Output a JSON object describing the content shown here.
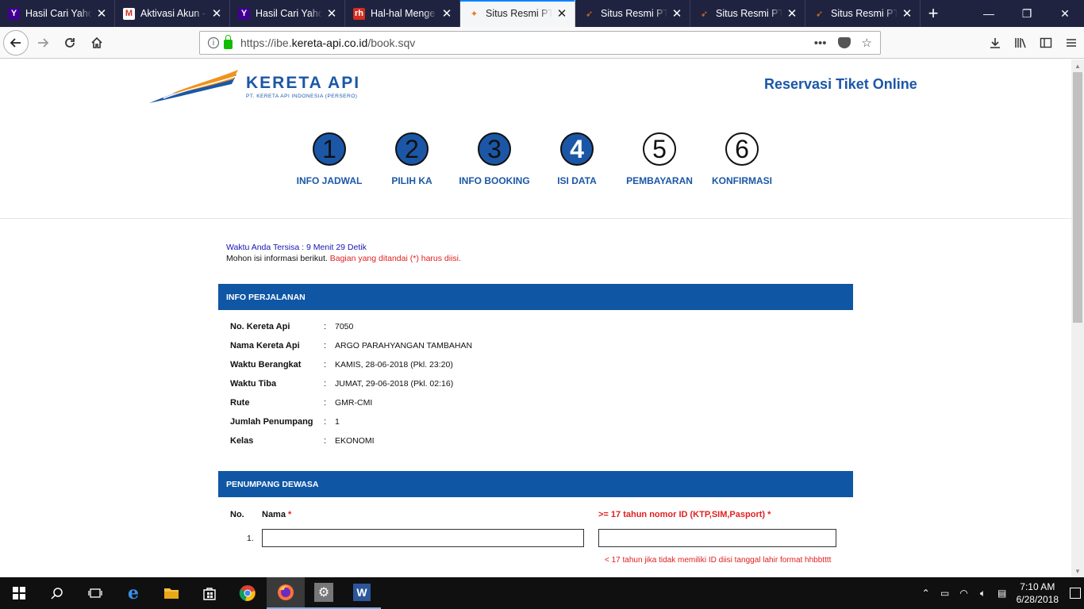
{
  "browser": {
    "tabs": [
      {
        "title": "Hasil Cari Yahoo",
        "favicon": "Y"
      },
      {
        "title": "Aktivasi Akun -",
        "favicon": "M"
      },
      {
        "title": "Hasil Cari Yahoo",
        "favicon": "Y"
      },
      {
        "title": "Hal-hal Menge",
        "favicon": "rh"
      },
      {
        "title": "Situs Resmi PT.",
        "favicon": "ka"
      },
      {
        "title": "Situs Resmi PT",
        "favicon": "ka"
      },
      {
        "title": "Situs Resmi PT",
        "favicon": "ka"
      },
      {
        "title": "Situs Resmi PT",
        "favicon": "ka"
      }
    ],
    "active_tab": 4,
    "url_prefix": "https://ibe.",
    "url_domain": "kereta-api.co.id",
    "url_path": "/book.sqv"
  },
  "header": {
    "logo_text": "KERETA API",
    "logo_subtitle": "PT. KERETA API INDONESIA (PERSERO)",
    "title": "Reservasi Tiket Online"
  },
  "steps": [
    {
      "num": "1",
      "label": "INFO JADWAL"
    },
    {
      "num": "2",
      "label": "PILIH KA"
    },
    {
      "num": "3",
      "label": "INFO BOOKING"
    },
    {
      "num": "4",
      "label": "ISI DATA"
    },
    {
      "num": "5",
      "label": "PEMBAYARAN"
    },
    {
      "num": "6",
      "label": "KONFIRMASI"
    }
  ],
  "current_step": 4,
  "timer_text": "Waktu Anda Tersisa : 9 Menit 29 Detik",
  "notice": {
    "text": "Mohon isi informasi berikut.",
    "required_text": "Bagian yang ditandai (*) harus diisi."
  },
  "trip_section": {
    "title": "INFO PERJALANAN",
    "rows": [
      {
        "label": "No. Kereta Api",
        "value": "7050"
      },
      {
        "label": "Nama Kereta Api",
        "value": "ARGO PARAHYANGAN TAMBAHAN"
      },
      {
        "label": "Waktu Berangkat",
        "value": "KAMIS, 28-06-2018 (Pkl. 23:20)"
      },
      {
        "label": "Waktu Tiba",
        "value": "JUMAT, 29-06-2018 (Pkl. 02:16)"
      },
      {
        "label": "Rute",
        "value": "GMR-CMI"
      },
      {
        "label": "Jumlah Penumpang",
        "value": "1"
      },
      {
        "label": "Kelas",
        "value": "EKONOMI"
      }
    ]
  },
  "passenger_section": {
    "title": "PENUMPANG DEWASA",
    "col_no": "No.",
    "col_name": "Nama",
    "col_id": ">= 17 tahun nomor ID (KTP,SIM,Pasport)",
    "required_mark": "*",
    "row_no": "1.",
    "name_value": "",
    "id_value": "",
    "hint": "< 17 tahun jika tidak memiliki ID diisi tanggal lahir format hhbbtttt"
  },
  "taskbar": {
    "time": "7:10 AM",
    "date": "6/28/2018"
  },
  "colors": {
    "brand_blue": "#1b57a6",
    "section_blue": "#0f56a4",
    "required_red": "#e02020",
    "tab_dark": "#202340"
  }
}
